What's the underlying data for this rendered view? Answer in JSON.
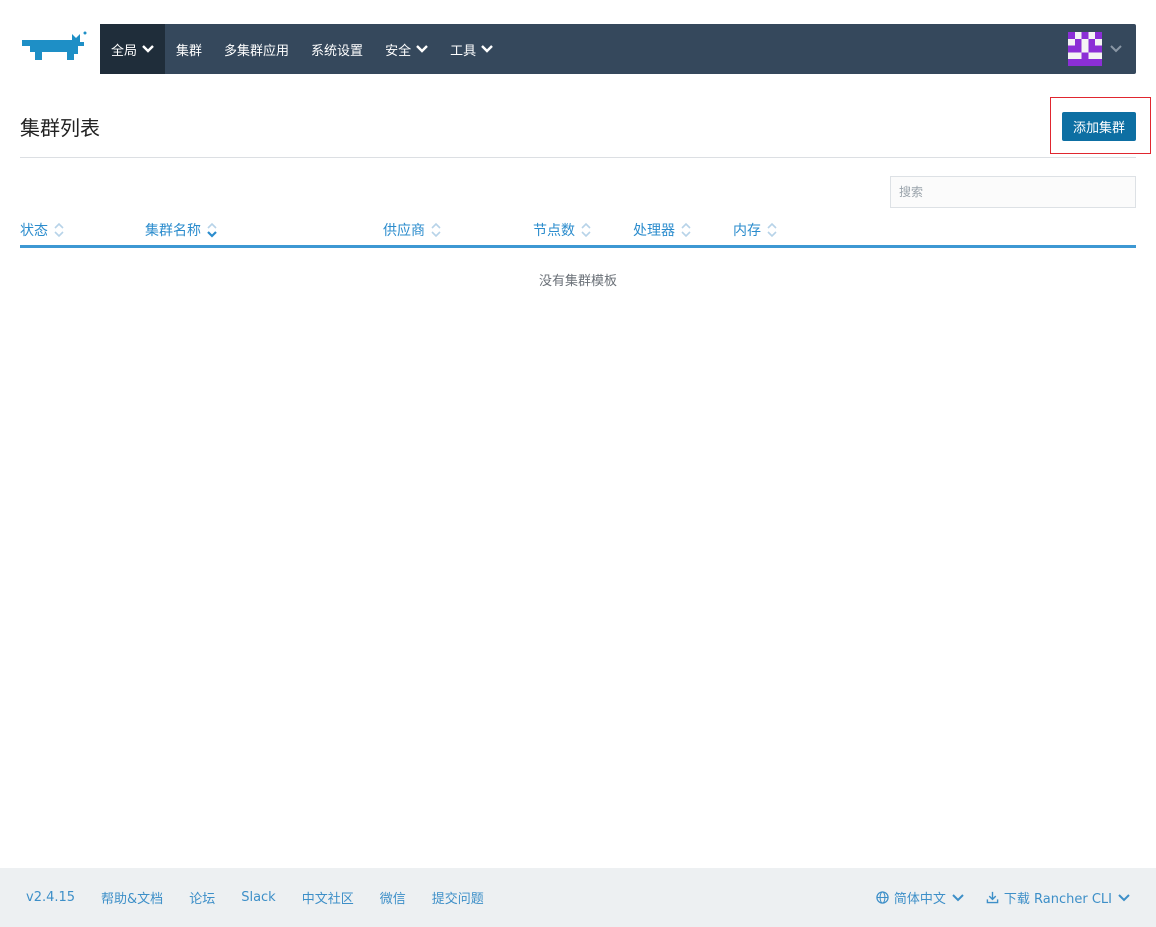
{
  "header": {
    "logo": "rancher-cow-logo",
    "nav": [
      {
        "label": "全局",
        "dropdown": true,
        "active": true
      },
      {
        "label": "集群",
        "dropdown": false,
        "active": false
      },
      {
        "label": "多集群应用",
        "dropdown": false,
        "active": false
      },
      {
        "label": "系统设置",
        "dropdown": false,
        "active": false
      },
      {
        "label": "安全",
        "dropdown": true,
        "active": false
      },
      {
        "label": "工具",
        "dropdown": true,
        "active": false
      }
    ],
    "user_avatar": "user-avatar-icon"
  },
  "page": {
    "title": "集群列表",
    "add_button_label": "添加集群",
    "search_placeholder": "搜索"
  },
  "table": {
    "columns": [
      "状态",
      "集群名称",
      "供应商",
      "节点数",
      "处理器",
      "内存"
    ],
    "sorted_column": "集群名称",
    "empty_text": "没有集群模板"
  },
  "footer": {
    "version": "v2.4.15",
    "links": [
      "帮助&文档",
      "论坛",
      "Slack",
      "中文社区",
      "微信",
      "提交问题"
    ],
    "language": "简体中文",
    "download": "下载 Rancher CLI"
  },
  "colors": {
    "nav_bg": "#35485c",
    "nav_active_bg": "#1f2d3a",
    "primary_button": "#0d6fa3",
    "link": "#2b8ccd",
    "highlight_border": "#e0262f",
    "footer_bg": "#edf0f2"
  }
}
